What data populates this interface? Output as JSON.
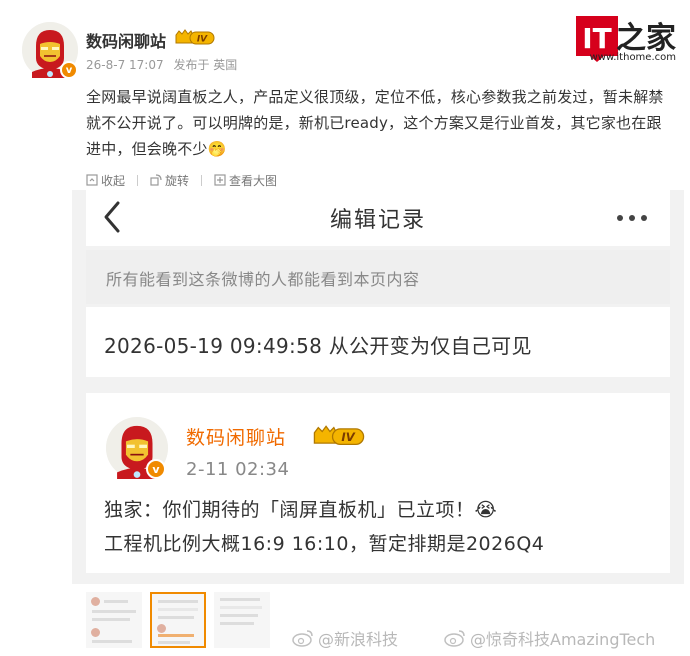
{
  "header": {
    "username": "数码闲聊站",
    "level_badge": "IV",
    "timestamp": "26-8-7 17:07",
    "published_from": "发布于 英国",
    "verified_mark": "v"
  },
  "watermark_logo": {
    "brand_text": "IT之家",
    "url": "www.ithome.com"
  },
  "post": {
    "text": "全网最早说阔直板之人，产品定义很顶级，定位不低，核心参数我之前发过，暂未解禁就不公开说了。可以明牌的是，新机已ready，这个方案又是行业首发，其它家也在跟进中，但会晚不少🤭"
  },
  "actions": [
    {
      "label": "收起",
      "icon": "collapse-icon"
    },
    {
      "label": "旋转",
      "icon": "rotate-icon"
    },
    {
      "label": "查看大图",
      "icon": "zoom-icon"
    }
  ],
  "embedded": {
    "title": "编辑记录",
    "notice": "所有能看到这条微博的人都能看到本页内容",
    "record": "2026-05-19 09:49:58 从公开变为仅自己可见",
    "inner_post": {
      "username": "数码闲聊站",
      "level_badge": "IV",
      "time": "2-11 02:34",
      "line1": "独家：你们期待的「阔屏直板机」已立项！😭",
      "line2": "工程机比例大概16:9 16:10，暂定排期是2026Q4"
    }
  },
  "watermarks": {
    "left": "@新浪科技",
    "right": "@惊奇科技AmazingTech"
  },
  "colors": {
    "accent_orange": "#f06a00",
    "ithome_red": "#d6001c",
    "text_main": "#333333",
    "text_muted": "#999999"
  }
}
